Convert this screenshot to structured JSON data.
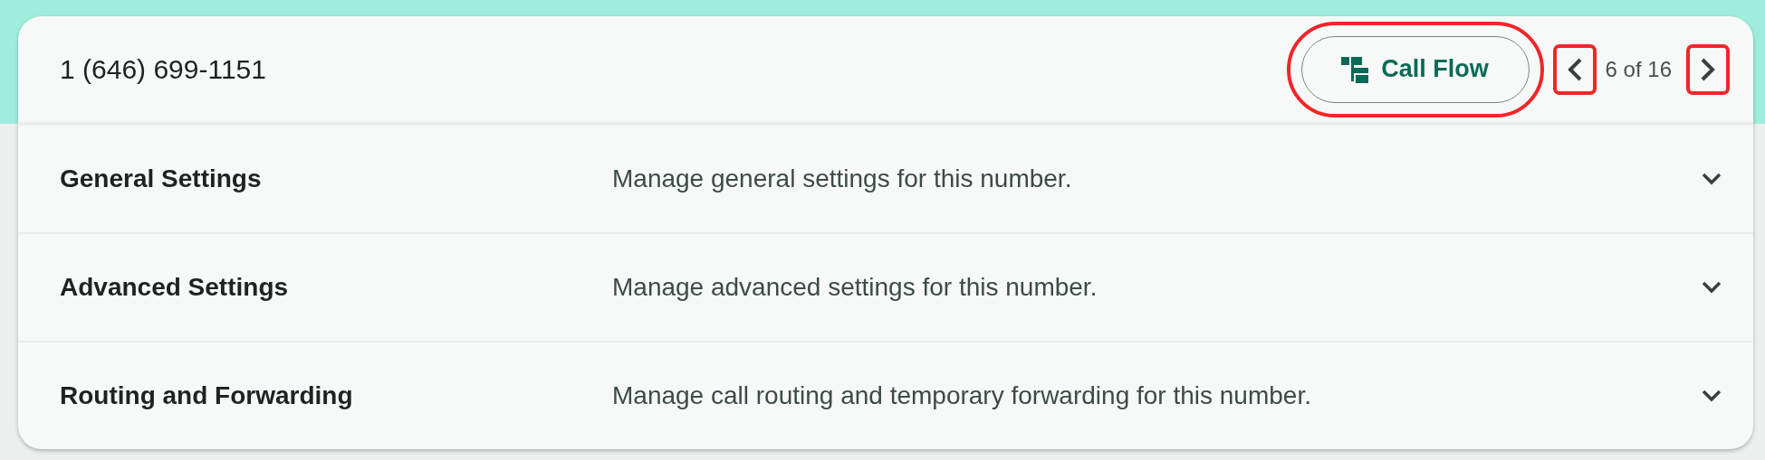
{
  "header": {
    "phone_number": "1 (646) 699-1151",
    "call_flow_button": {
      "label": "Call Flow",
      "highlighted": true
    },
    "pager": {
      "prev_highlighted": true,
      "text": "6 of 16",
      "next_highlighted": true
    }
  },
  "sections": [
    {
      "title": "General Settings",
      "description": "Manage general settings for this number.",
      "expanded": false
    },
    {
      "title": "Advanced Settings",
      "description": "Manage advanced settings for this number.",
      "expanded": false
    },
    {
      "title": "Routing and Forwarding",
      "description": "Manage call routing and temporary forwarding for this number.",
      "expanded": false
    }
  ]
}
